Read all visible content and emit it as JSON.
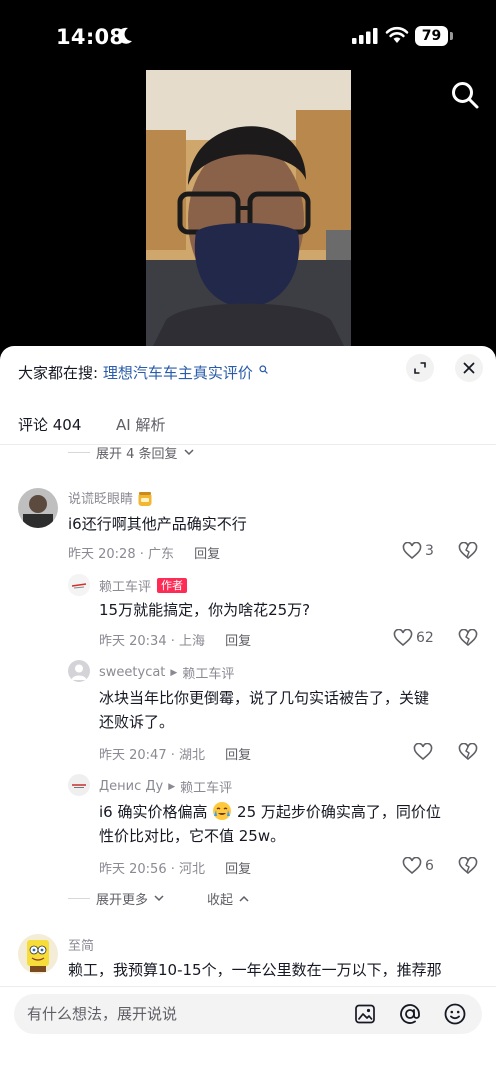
{
  "status_bar": {
    "time": "14:08",
    "battery": "79"
  },
  "header": {
    "hot_search_label": "大家都在搜:",
    "hot_search_term": "理想汽车车主真实评价"
  },
  "tabs": [
    {
      "label": "评论 404"
    },
    {
      "label": "AI 解析"
    }
  ],
  "thread": {
    "expand_top": "展开 4 条回复",
    "comment": {
      "user": "说谎眨眼睛",
      "text": "i6还行啊其他产品确实不行",
      "time": "昨天 20:28 · 广东",
      "reply": "回复",
      "likes": "3"
    },
    "replies": [
      {
        "user": "赖工车评",
        "badge": "作者",
        "text": "15万就能搞定，你为啥花25万?",
        "time": "昨天 20:34 · 上海",
        "reply": "回复",
        "likes": "62"
      },
      {
        "user": "sweetycat",
        "reply_to": "赖工车评",
        "text_lines": [
          "冰块当年比你更倒霉，说了几句实话被告了，关键",
          "还败诉了。"
        ],
        "time": "昨天 20:47 · 湖北",
        "reply": "回复",
        "likes": ""
      },
      {
        "user": "Денис Ду",
        "reply_to": "赖工车评",
        "text_line1_a": "i6 确实价格偏高",
        "text_line1_b": "25 万起步价确实高了，同价位",
        "text_line2": "性价比对比，它不值 25w。",
        "time": "昨天 20:56 · 河北",
        "reply": "回复",
        "likes": "6"
      }
    ],
    "expand_more": "展开更多",
    "collapse": "收起"
  },
  "next_comment": {
    "user": "至简",
    "text": "赖工，我预算10-15个，一年公里数在一万以下，推荐那"
  },
  "input": {
    "placeholder": "有什么想法，展开说说"
  },
  "icons": {
    "search": "search-icon",
    "expand": "expand-icon",
    "close": "close-icon",
    "like": "heart-icon",
    "dislike": "broken-heart-icon",
    "image": "image-icon",
    "mention": "at-icon",
    "emoji": "emoji-icon"
  },
  "colors": {
    "accent": "#fe2c55",
    "link": "#2a5caa",
    "text": "#161823",
    "muted": "#8a8a93"
  }
}
